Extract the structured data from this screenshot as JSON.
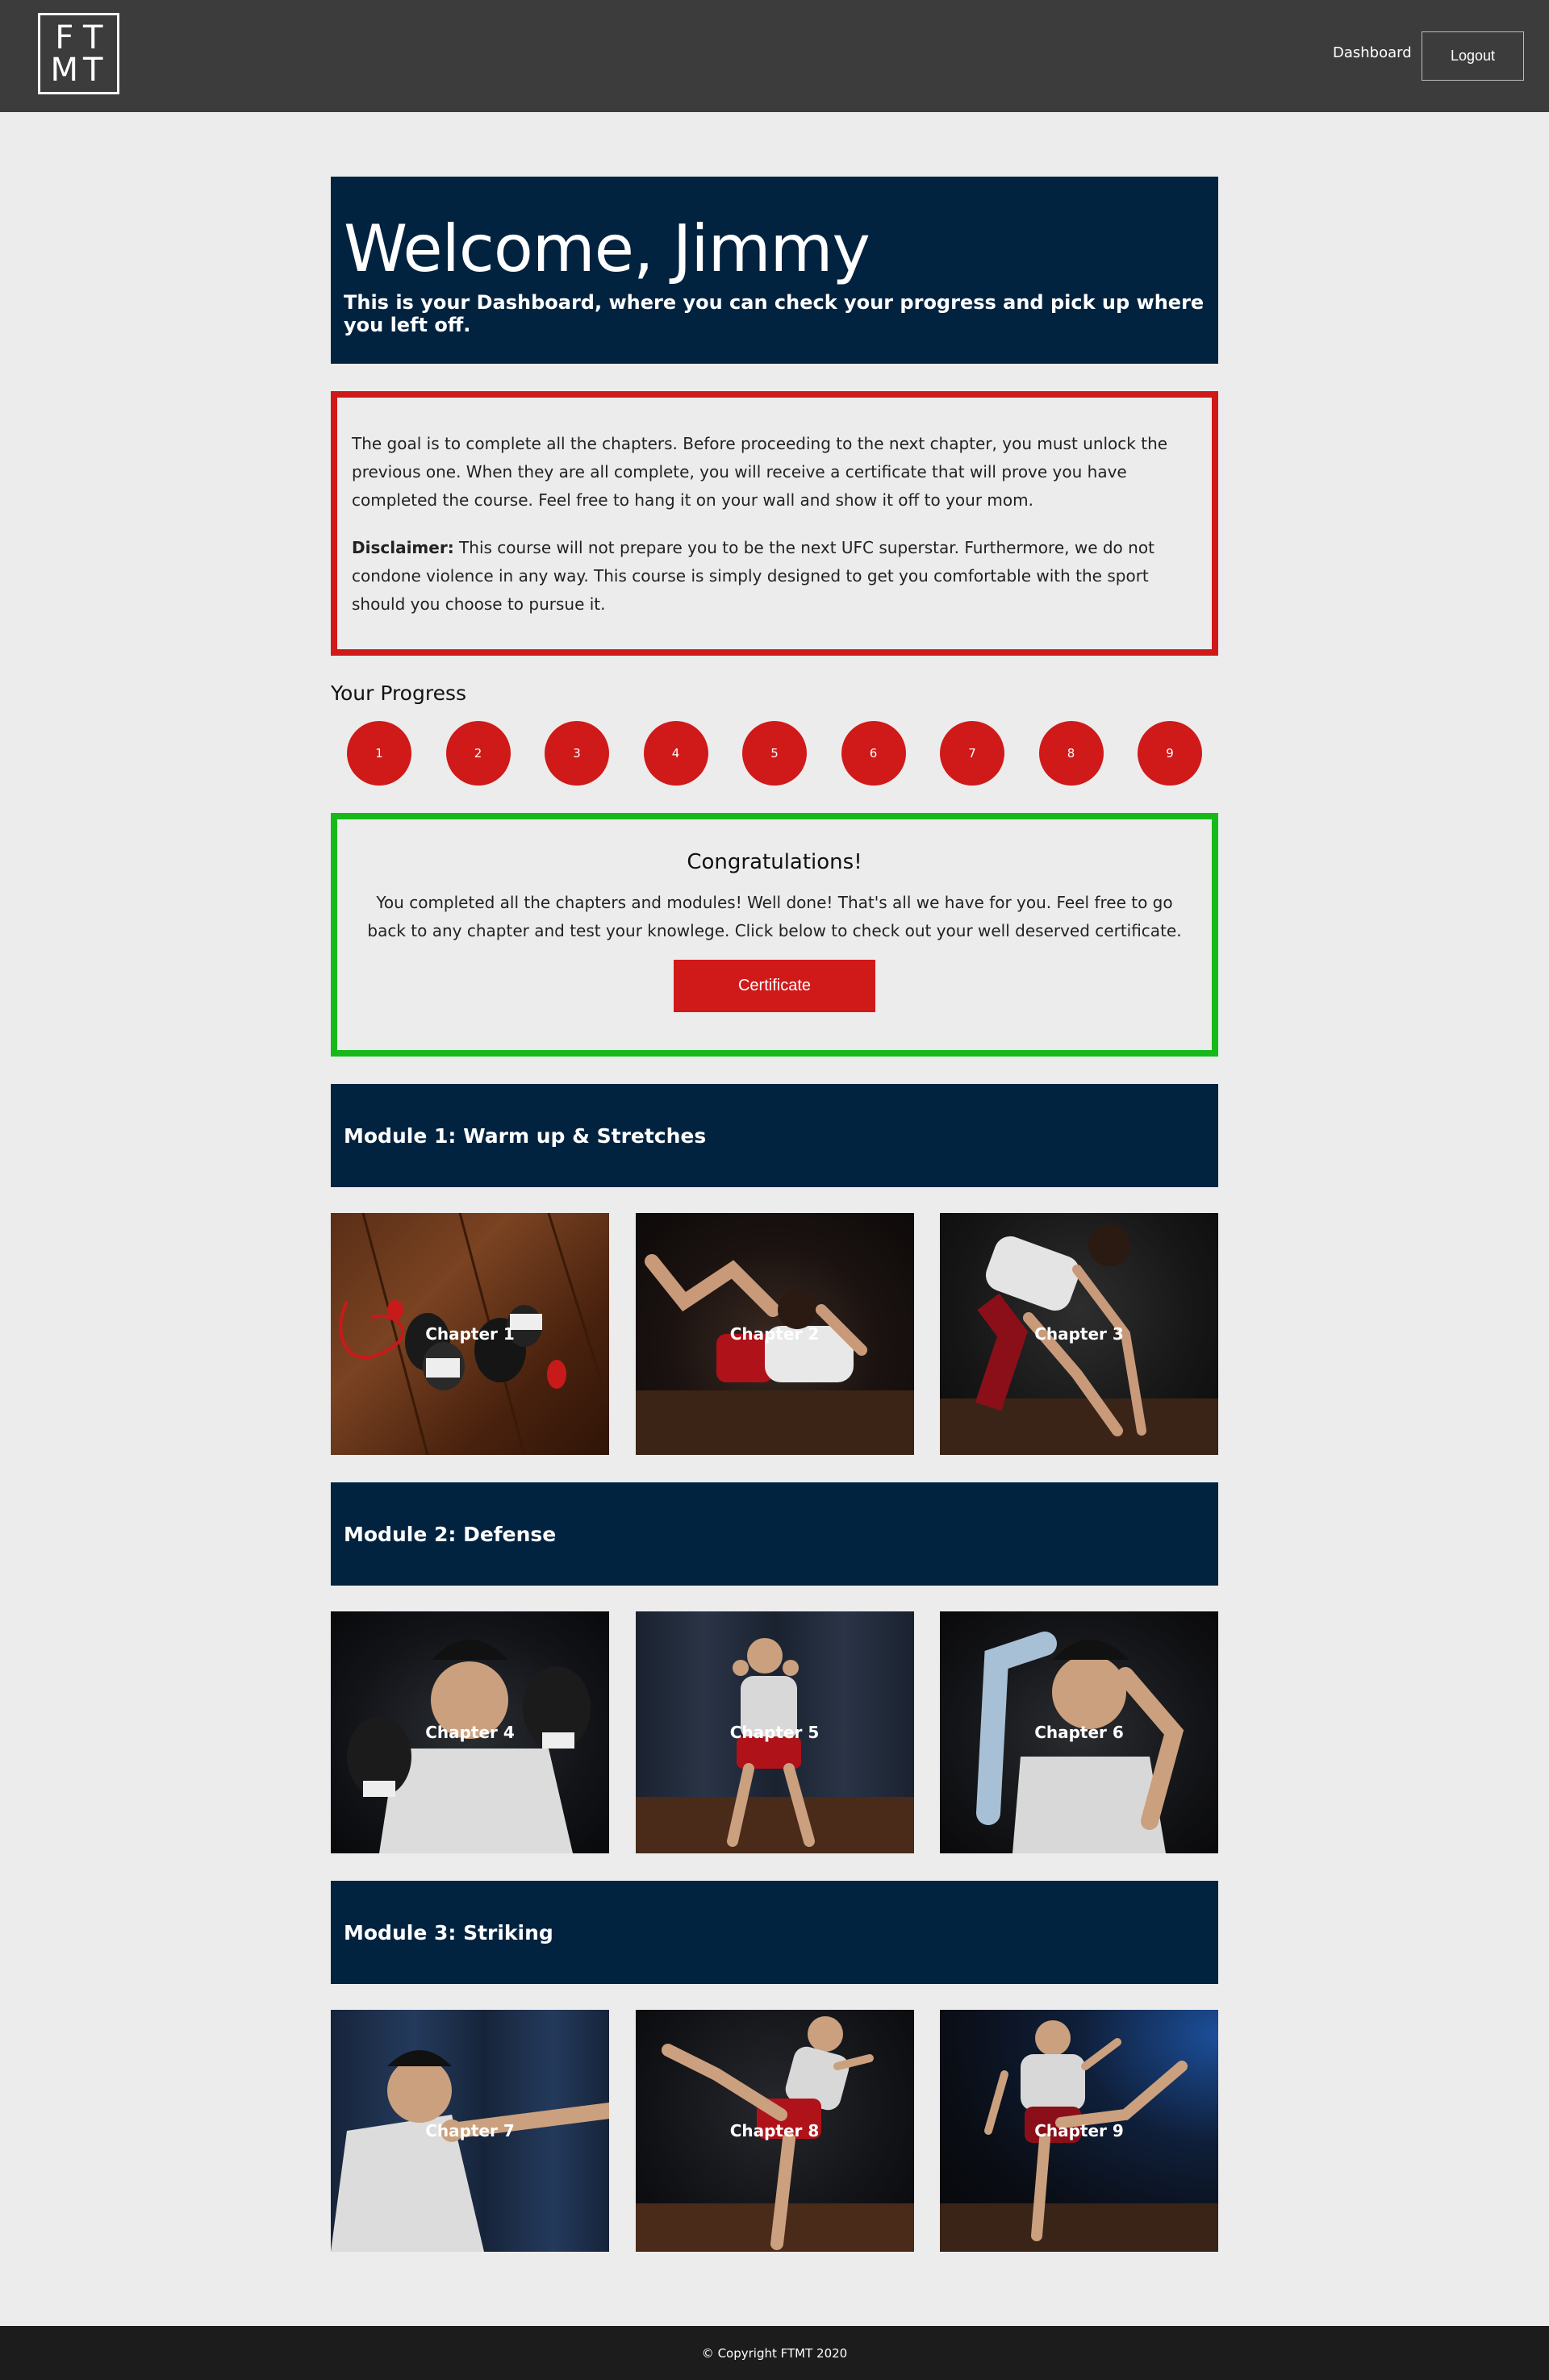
{
  "header": {
    "logo_letters": [
      "F",
      "T",
      "M",
      "T"
    ],
    "nav_dashboard": "Dashboard",
    "nav_logout": "Logout"
  },
  "welcome": {
    "title": "Welcome, Jimmy",
    "subtitle": "This is your Dashboard, where you can check your progress and pick up where you left off."
  },
  "info": {
    "paragraph1": "The goal is to complete all the chapters. Before proceeding to the next chapter, you must unlock the previous one. When they are all complete, you will receive a certificate that will prove you have completed the course. Feel free to hang it on your wall and show it off to your mom.",
    "disclaimer_label": "Disclaimer:",
    "disclaimer_text": " This course will not prepare you to be the next UFC superstar. Furthermore, we do not condone violence in any way. This course is simply designed to get you comfortable with the sport should you choose to pursue it."
  },
  "progress": {
    "title": "Your Progress",
    "steps": [
      "1",
      "2",
      "3",
      "4",
      "5",
      "6",
      "7",
      "8",
      "9"
    ]
  },
  "congrats": {
    "title": "Congratulations!",
    "message": "You completed all the chapters and modules! Well done! That's all we have for you. Feel free to go back to any chapter and test your knowlege. Click below to check out your well deserved certificate.",
    "button_label": "Certificate"
  },
  "modules": [
    {
      "title": "Module 1: Warm up & Stretches",
      "chapters": [
        {
          "label": "Chapter 1",
          "image": "boxing-gloves-on-floor"
        },
        {
          "label": "Chapter 2",
          "image": "man-doing-crunches"
        },
        {
          "label": "Chapter 3",
          "image": "man-stretching-hamstrings"
        }
      ]
    },
    {
      "title": "Module 2: Defense",
      "chapters": [
        {
          "label": "Chapter 4",
          "image": "boxer-guard-closeup"
        },
        {
          "label": "Chapter 5",
          "image": "fighter-stance-full-body"
        },
        {
          "label": "Chapter 6",
          "image": "elbow-block-closeup"
        }
      ]
    },
    {
      "title": "Module 3: Striking",
      "chapters": [
        {
          "label": "Chapter 7",
          "image": "man-throwing-jab"
        },
        {
          "label": "Chapter 8",
          "image": "roundhouse-kick"
        },
        {
          "label": "Chapter 9",
          "image": "front-kick"
        }
      ]
    }
  ],
  "footer": {
    "copyright": "© Copyright FTMT 2020"
  },
  "colors": {
    "header_bg": "#3c3c3c",
    "page_bg": "#ececec",
    "navy": "#022340",
    "red": "#d01919",
    "green": "#17b91a",
    "footer_bg": "#1c1c1c"
  }
}
